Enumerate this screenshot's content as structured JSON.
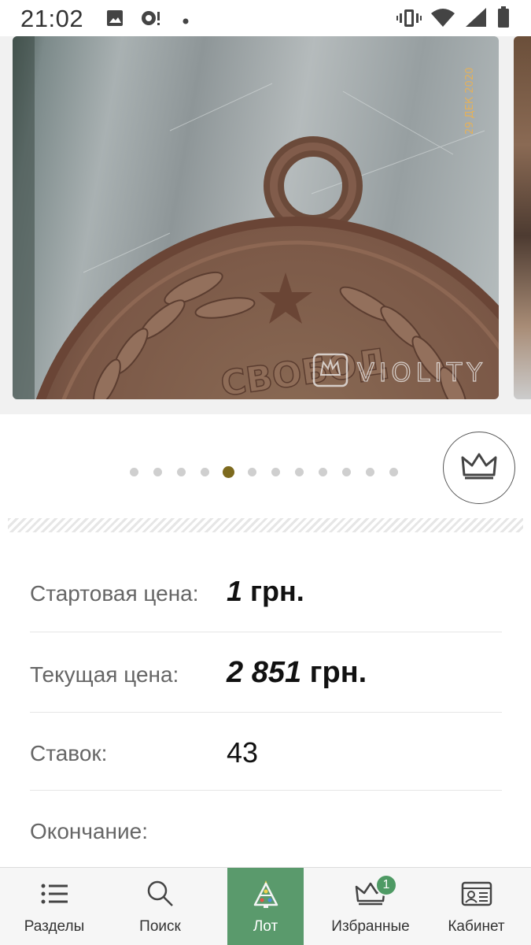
{
  "status_bar": {
    "time": "21:02",
    "left_icons": [
      "image-icon",
      "notification-icon",
      "dot-icon"
    ],
    "right_icons": [
      "vibrate-icon",
      "wifi-icon",
      "signal-icon",
      "battery-icon"
    ]
  },
  "gallery": {
    "watermark_text": "VIOLITY",
    "photo_stamp": "29 ДЕК 2020",
    "medal_text": "СВОБОД",
    "dots_total": 12,
    "active_dot": 5
  },
  "colors": {
    "accent_green": "#5a9a6c",
    "active_dot": "#7d6a1e"
  },
  "lot": {
    "start_price_label": "Стартовая цена:",
    "start_price_number": "1",
    "start_price_currency": " грн.",
    "current_price_label": "Текущая цена:",
    "current_price_number": "2 851",
    "current_price_currency": " грн.",
    "bids_label": "Ставок:",
    "bids_value": "43",
    "end_label": "Окончание:"
  },
  "bottom_nav": {
    "items": [
      {
        "label": "Разделы",
        "icon": "list-icon"
      },
      {
        "label": "Поиск",
        "icon": "search-icon"
      },
      {
        "label": "Лот",
        "icon": "lot-tree-icon"
      },
      {
        "label": "Избранные",
        "icon": "crown-icon",
        "badge": "1"
      },
      {
        "label": "Кабинет",
        "icon": "id-card-icon"
      }
    ],
    "active_index": 2
  }
}
